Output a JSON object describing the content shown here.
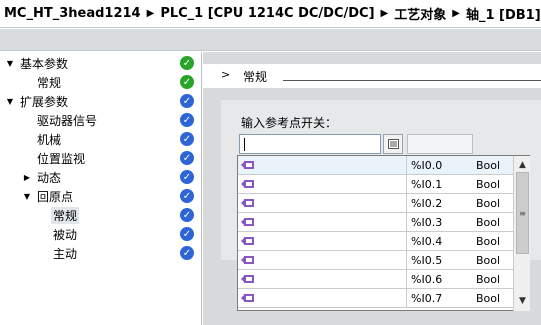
{
  "breadcrumb": [
    "MC_HT_3head1214",
    "PLC_1 [CPU 1214C DC/DC/DC]",
    "工艺对象",
    "轴_1 [DB1]"
  ],
  "breadcrumb_separator": "▶",
  "nav": {
    "items": [
      {
        "label": "基本参数",
        "arrow": "▼",
        "status": "green"
      },
      {
        "label": "常规",
        "arrow": "",
        "status": "green"
      },
      {
        "label": "扩展参数",
        "arrow": "▼",
        "status": "blue"
      },
      {
        "label": "驱动器信号",
        "arrow": "",
        "status": "blue"
      },
      {
        "label": "机械",
        "arrow": "",
        "status": "blue"
      },
      {
        "label": "位置监视",
        "arrow": "",
        "status": "blue"
      },
      {
        "label": "动态",
        "arrow": "▶",
        "status": "blue"
      },
      {
        "label": "回原点",
        "arrow": "▼",
        "status": "blue"
      },
      {
        "label": "常规",
        "arrow": "",
        "status": "blue"
      },
      {
        "label": "被动",
        "arrow": "",
        "status": "blue"
      },
      {
        "label": "主动",
        "arrow": "",
        "status": "blue"
      }
    ],
    "selected_index": 8
  },
  "section": {
    "chevron": ">",
    "title": "常规"
  },
  "field": {
    "label": "输入参考点开关：",
    "value": "",
    "button_icon": "list-icon"
  },
  "dropdown": {
    "rows": [
      {
        "address": "%I0.0",
        "type": "Bool"
      },
      {
        "address": "%I0.1",
        "type": "Bool"
      },
      {
        "address": "%I0.2",
        "type": "Bool"
      },
      {
        "address": "%I0.3",
        "type": "Bool"
      },
      {
        "address": "%I0.4",
        "type": "Bool"
      },
      {
        "address": "%I0.5",
        "type": "Bool"
      },
      {
        "address": "%I0.6",
        "type": "Bool"
      },
      {
        "address": "%I0.7",
        "type": "Bool"
      }
    ],
    "scroll_up": "▲",
    "scroll_down": "▼",
    "thumb_grip": "≡"
  },
  "colors": {
    "ok": "#28a428",
    "info": "#2d64d6",
    "tag_icon": "#8a57c2"
  }
}
